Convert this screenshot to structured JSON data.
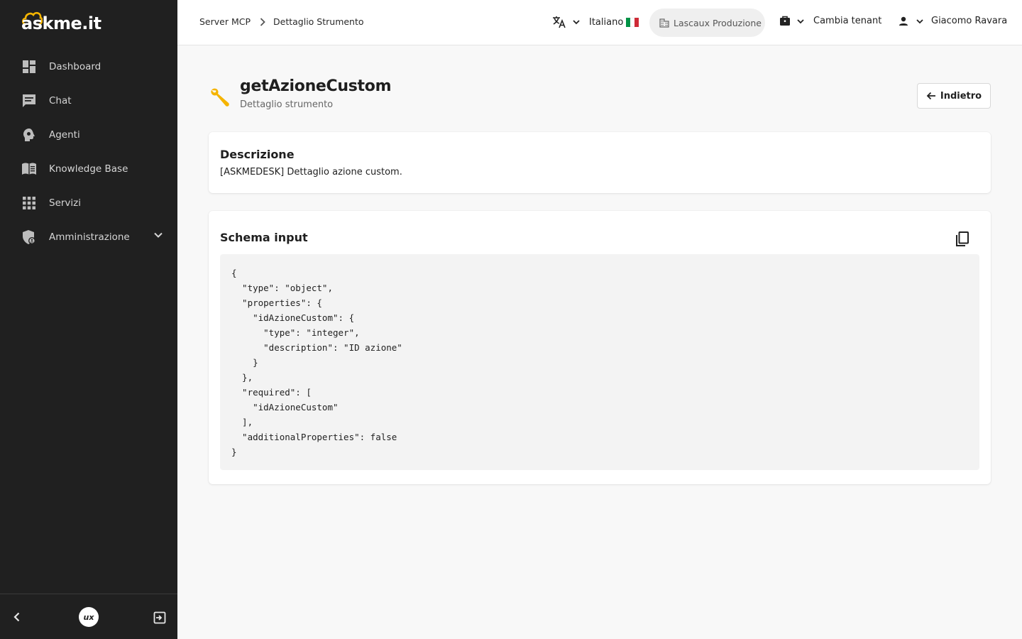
{
  "brand": {
    "logo_text": "askme.it"
  },
  "sidebar": {
    "items": [
      {
        "label": "Dashboard",
        "icon": "dashboard-icon"
      },
      {
        "label": "Chat",
        "icon": "chat-icon"
      },
      {
        "label": "Agenti",
        "icon": "agent-icon"
      },
      {
        "label": "Knowledge Base",
        "icon": "book-icon"
      },
      {
        "label": "Servizi",
        "icon": "apps-grid-icon"
      },
      {
        "label": "Amministrazione",
        "icon": "admin-shield-icon"
      }
    ],
    "footer": {
      "ux_label": "ux"
    }
  },
  "topbar": {
    "breadcrumb": [
      "Server MCP",
      "Dettaglio Strumento"
    ],
    "language": "Italiano",
    "tenant": "Lascaux Produzione",
    "change_tenant": "Cambia tenant",
    "user": "Giacomo Ravara"
  },
  "page": {
    "title": "getAzioneCustom",
    "subtitle": "Dettaglio strumento",
    "back_label": "Indietro"
  },
  "description_card": {
    "title": "Descrizione",
    "text": "[ASKMEDESK] Dettaglio azione custom."
  },
  "schema_card": {
    "title": "Schema input",
    "code": "{\n  \"type\": \"object\",\n  \"properties\": {\n    \"idAzioneCustom\": {\n      \"type\": \"integer\",\n      \"description\": \"ID azione\"\n    }\n  },\n  \"required\": [\n    \"idAzioneCustom\"\n  ],\n  \"additionalProperties\": false\n}"
  },
  "colors": {
    "sidebar_bg": "#202020",
    "accent_yellow": "#f5b400",
    "flag_green": "#009246",
    "flag_white": "#ffffff",
    "flag_red": "#ce2b37"
  }
}
